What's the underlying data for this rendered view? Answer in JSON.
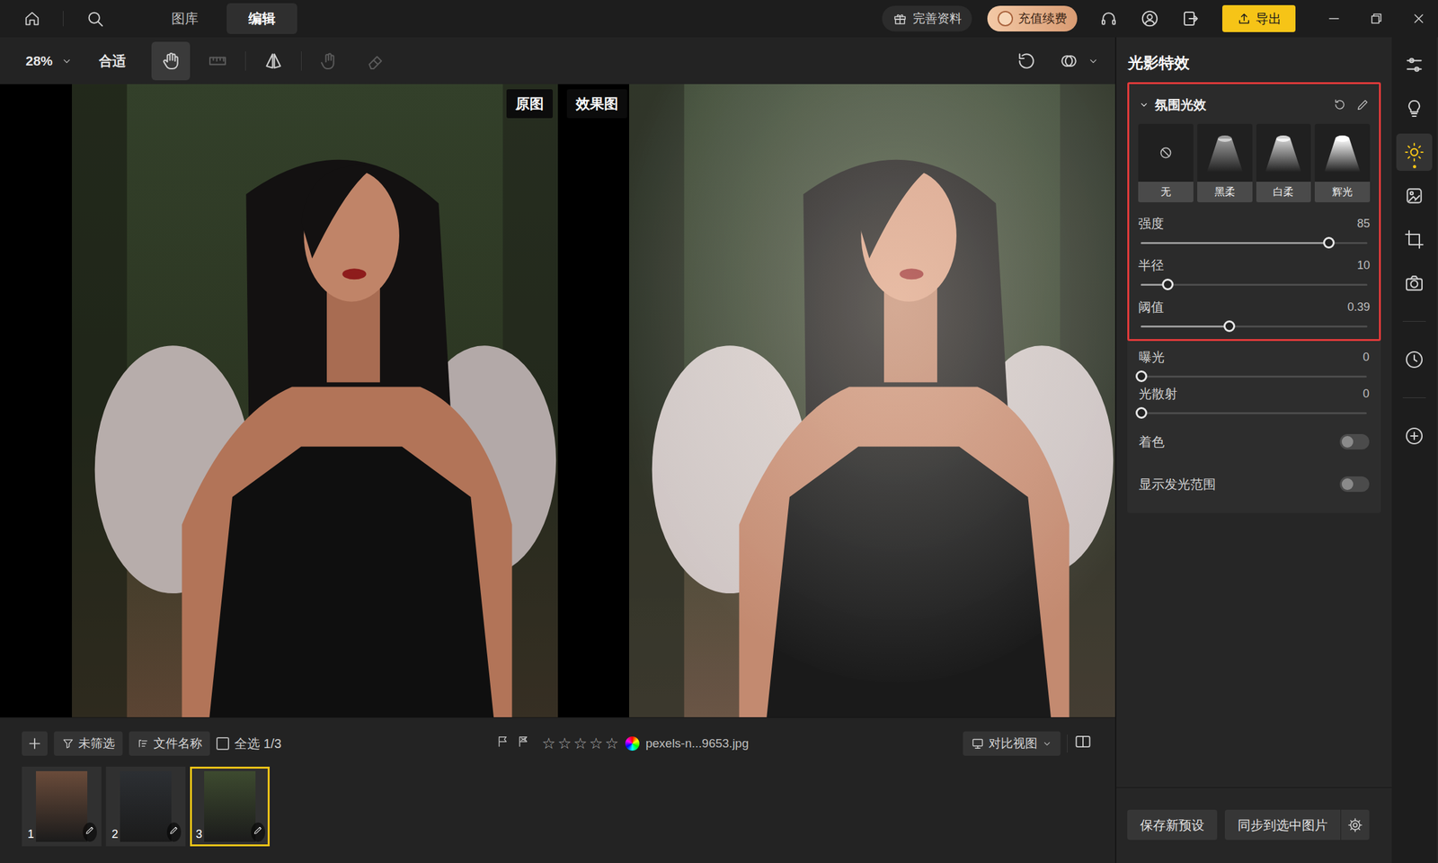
{
  "topbar": {
    "tabs": [
      {
        "label": "图库",
        "selected": false
      },
      {
        "label": "编辑",
        "selected": true
      }
    ],
    "profile": "完善资料",
    "recharge": "充值续费",
    "export": "导出"
  },
  "toolbar": {
    "zoom": "28%",
    "fit": "合适",
    "tools": [
      {
        "kind": "hand",
        "selected": true,
        "disabled": false
      },
      {
        "kind": "ruler",
        "selected": false,
        "disabled": true
      },
      {
        "kind": "flip",
        "selected": false,
        "disabled": false
      },
      {
        "kind": "brush",
        "selected": false,
        "disabled": true
      },
      {
        "kind": "eraser",
        "selected": false,
        "disabled": true
      }
    ]
  },
  "canvas": {
    "panes": [
      {
        "label": "原图",
        "kind": "original"
      },
      {
        "label": "效果图",
        "kind": "effect"
      }
    ]
  },
  "panel": {
    "title": "光影特效",
    "section": {
      "title": "氛围光效",
      "expanded": true,
      "highlighted": true,
      "presets": [
        {
          "label": "无",
          "kind": "none",
          "selected": false
        },
        {
          "label": "黑柔",
          "kind": "black-soft",
          "selected": false
        },
        {
          "label": "白柔",
          "kind": "white-soft",
          "selected": false
        },
        {
          "label": "辉光",
          "kind": "glow",
          "selected": false
        }
      ],
      "sliders": [
        {
          "label": "强度",
          "reading": "85",
          "level": 0.83
        },
        {
          "label": "半径",
          "reading": "10",
          "level": 0.12
        },
        {
          "label": "阈值",
          "reading": "0.39",
          "level": 0.39
        }
      ]
    },
    "rows": [
      {
        "kind": "slider",
        "label": "曝光",
        "reading": "0",
        "level": 0
      },
      {
        "kind": "slider",
        "label": "光散射",
        "reading": "0",
        "level": 0
      },
      {
        "kind": "toggle",
        "label": "着色",
        "on": false
      },
      {
        "kind": "toggle",
        "label": "显示发光范围",
        "on": false
      }
    ],
    "buttons": [
      "保存新预设",
      "同步到选中图片"
    ]
  },
  "sidebar": {
    "tools": [
      {
        "kind": "adjust",
        "selected": false
      },
      {
        "kind": "bulb",
        "selected": false
      },
      {
        "kind": "light",
        "selected": true
      },
      {
        "kind": "retouch",
        "selected": false
      },
      {
        "kind": "crop",
        "selected": false
      },
      {
        "kind": "camera",
        "selected": false
      },
      {
        "kind": "history",
        "selected": false
      },
      {
        "kind": "add",
        "selected": false
      }
    ]
  },
  "filmstrip": {
    "filter": "未筛选",
    "sort": "文件名称",
    "select_all": {
      "label": "全选 1/3",
      "checked": false
    },
    "flags": [
      {
        "kind": "pick",
        "on": false
      },
      {
        "kind": "reject",
        "on": false
      }
    ],
    "stars": 0,
    "filename": "pexels-n...9653.jpg",
    "view": "对比视图",
    "thumbnails": [
      {
        "number": "1",
        "selected": false
      },
      {
        "number": "2",
        "selected": false
      },
      {
        "number": "3",
        "selected": true
      }
    ]
  }
}
